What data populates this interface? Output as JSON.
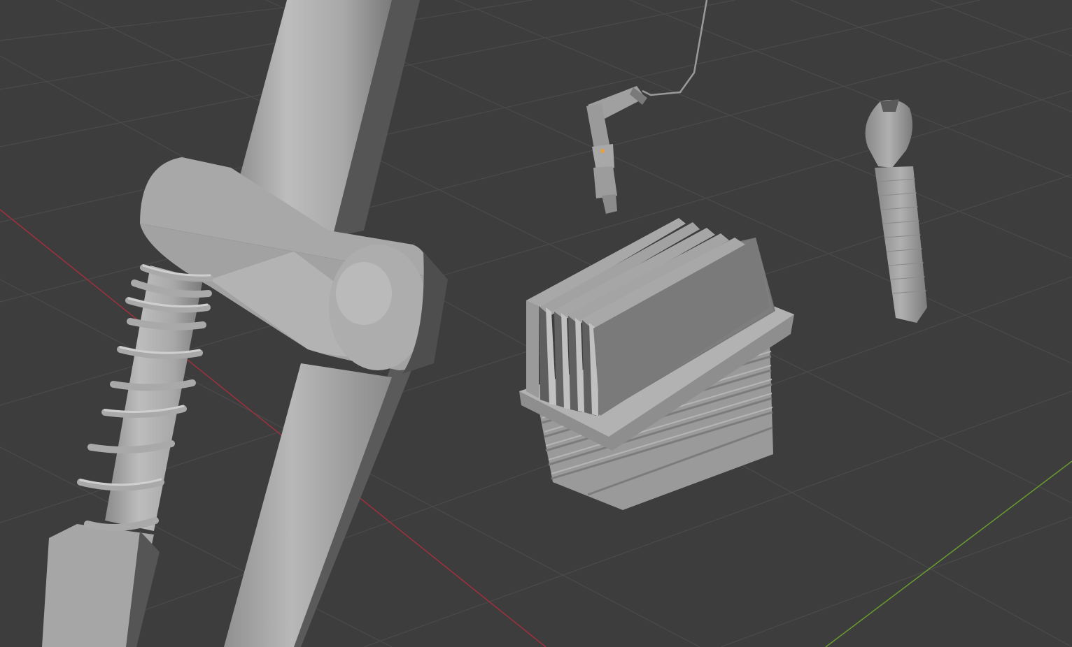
{
  "viewport": {
    "background": "#3d3d3d",
    "grid_color": "#4a4a4a",
    "x_axis_color": "#a0303c",
    "y_axis_color": "#6a9a30",
    "mesh_light": "#b4b4b4",
    "mesh_mid": "#999999",
    "mesh_dark": "#6e6e6e",
    "mesh_shadow": "#505050",
    "origin_color": "#e8a040"
  },
  "objects": [
    "frame-tube-mesh",
    "coil-spring-mesh",
    "engine-cylinder-mesh",
    "bent-connector-mesh",
    "spark-plug-mesh",
    "wire-curve"
  ]
}
